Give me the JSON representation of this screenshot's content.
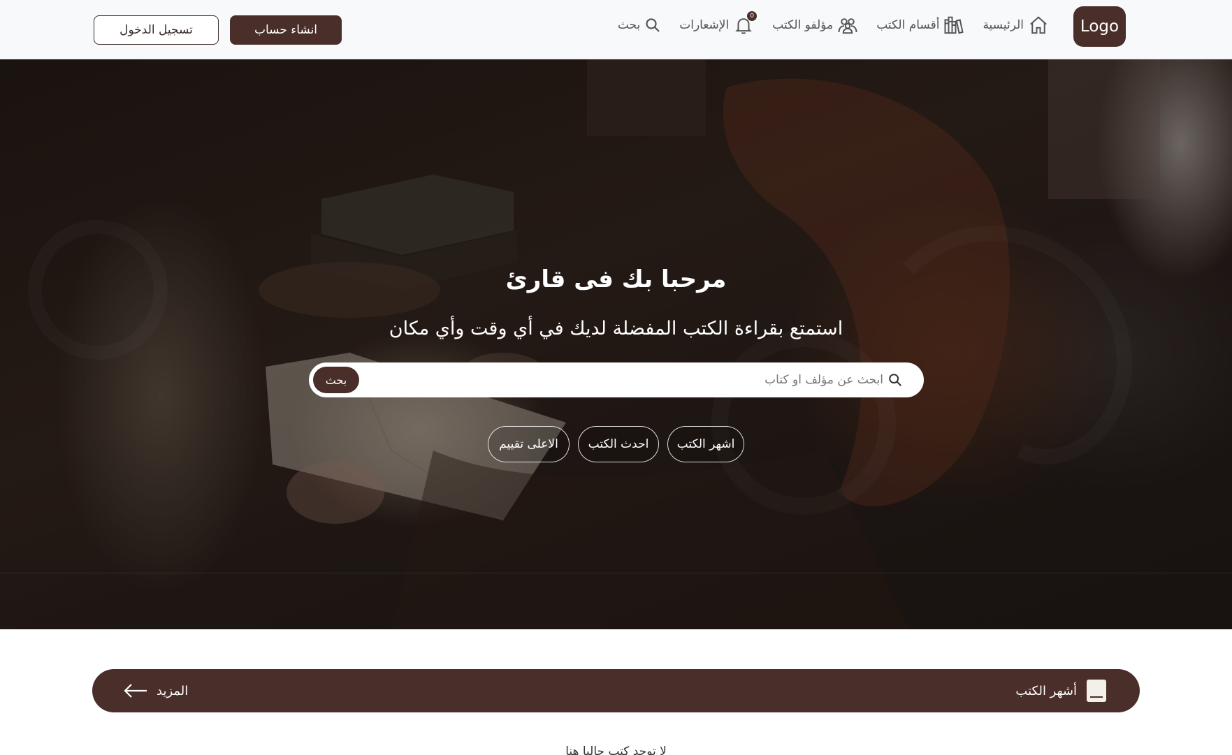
{
  "header": {
    "logo": "Logo",
    "nav": [
      {
        "label": "الرئيسية",
        "icon": "home-icon"
      },
      {
        "label": "أقسام الكتب",
        "icon": "bookshelf-icon"
      },
      {
        "label": "مؤلفو الكتب",
        "icon": "users-icon"
      },
      {
        "label": "الإشعارات",
        "icon": "bell-icon",
        "badge": "0"
      },
      {
        "label": "بحث",
        "icon": "search-icon"
      }
    ],
    "register_label": "انشاء حساب",
    "login_label": "تسجيل الدخول"
  },
  "hero": {
    "title": "مرحبا بك فى قارئ",
    "subtitle": "استمتع بقراءة الكتب المفضلة لديك في أي وقت وأي مكان",
    "search": {
      "placeholder": "ابحث عن مؤلف او كتاب",
      "button_label": "بحث"
    },
    "filters": [
      "اشهر الكتب",
      "احدث الكتب",
      "الاعلى تقييم"
    ]
  },
  "section": {
    "title": "أشهر الكتب",
    "more_label": "المزيد",
    "empty_text": "لا توجد كتب حاليا هنا"
  },
  "colors": {
    "brand": "#4a2e2a",
    "header_bg": "#f8f9fb"
  }
}
